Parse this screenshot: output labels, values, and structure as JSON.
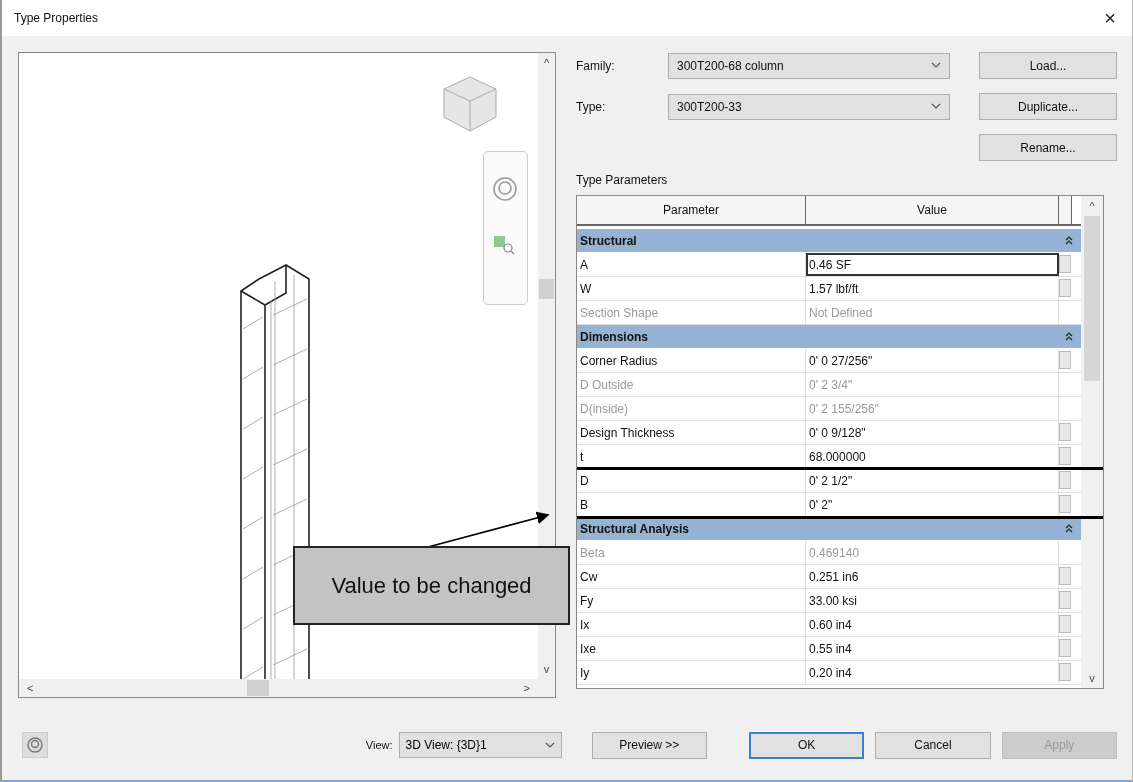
{
  "window": {
    "title": "Type Properties",
    "close": "×"
  },
  "preview": {
    "nav_up": "^",
    "nav_down": "v",
    "nav_left": "<",
    "nav_right": ">"
  },
  "family": {
    "label": "Family:",
    "value": "300T200-68 column"
  },
  "type": {
    "label": "Type:",
    "value": "300T200-33"
  },
  "side_buttons": [
    "Load...",
    "Duplicate...",
    "Rename..."
  ],
  "type_parameters": {
    "title": "Type Parameters",
    "columns": [
      "Parameter",
      "Value"
    ],
    "groups": [
      {
        "name": "Structural",
        "expanded": true,
        "rows": [
          {
            "name": "A",
            "value": "0.46 SF",
            "disabled": false,
            "editable": true,
            "selected": true,
            "highlighted": false
          },
          {
            "name": "W",
            "value": "1.57 lbf/ft",
            "disabled": false,
            "editable": true,
            "selected": false,
            "highlighted": false
          },
          {
            "name": "Section Shape",
            "value": "Not Defined",
            "disabled": true,
            "editable": false,
            "selected": false,
            "highlighted": false
          }
        ]
      },
      {
        "name": "Dimensions",
        "expanded": true,
        "rows": [
          {
            "name": "Corner Radius",
            "value": "0'  0 27/256\"",
            "disabled": false,
            "editable": true,
            "selected": false,
            "highlighted": false
          },
          {
            "name": "D Outside",
            "value": "0'  2 3/4\"",
            "disabled": true,
            "editable": false,
            "selected": false,
            "highlighted": false
          },
          {
            "name": "D(inside)",
            "value": "0'  2 155/256\"",
            "disabled": true,
            "editable": false,
            "selected": false,
            "highlighted": false
          },
          {
            "name": "Design Thickness",
            "value": "0'  0 9/128\"",
            "disabled": false,
            "editable": true,
            "selected": false,
            "highlighted": false
          },
          {
            "name": "t",
            "value": "68.000000",
            "disabled": false,
            "editable": true,
            "selected": false,
            "highlighted": false
          },
          {
            "name": "D",
            "value": "0'  2 1/2\"",
            "disabled": false,
            "editable": true,
            "selected": false,
            "highlighted": true
          },
          {
            "name": "B",
            "value": "0'  2\"",
            "disabled": false,
            "editable": true,
            "selected": false,
            "highlighted": true
          }
        ]
      },
      {
        "name": "Structural Analysis",
        "expanded": true,
        "rows": [
          {
            "name": "Beta",
            "value": "0.469140",
            "disabled": true,
            "editable": false,
            "selected": false,
            "highlighted": false
          },
          {
            "name": "Cw",
            "value": "0.251 in6",
            "disabled": false,
            "editable": true,
            "selected": false,
            "highlighted": false
          },
          {
            "name": "Fy",
            "value": "33.00 ksi",
            "disabled": false,
            "editable": true,
            "selected": false,
            "highlighted": false
          },
          {
            "name": "Ix",
            "value": "0.60 in4",
            "disabled": false,
            "editable": true,
            "selected": false,
            "highlighted": false
          },
          {
            "name": "Ixe",
            "value": "0.55 in4",
            "disabled": false,
            "editable": true,
            "selected": false,
            "highlighted": false
          },
          {
            "name": "Iy",
            "value": "0.20 in4",
            "disabled": false,
            "editable": true,
            "selected": false,
            "highlighted": false
          }
        ]
      }
    ]
  },
  "table_scroll": {
    "up": "^",
    "down": "v"
  },
  "view": {
    "label": "View:",
    "value": "3D View: {3D}1"
  },
  "buttons": [
    {
      "label": "Preview >>",
      "kind": "normal",
      "disabled": false
    },
    {
      "label": "OK",
      "kind": "default",
      "disabled": false
    },
    {
      "label": "Cancel",
      "kind": "normal",
      "disabled": false
    },
    {
      "label": "Apply",
      "kind": "normal",
      "disabled": true
    }
  ],
  "annotation": {
    "text": "Value to be changed"
  }
}
